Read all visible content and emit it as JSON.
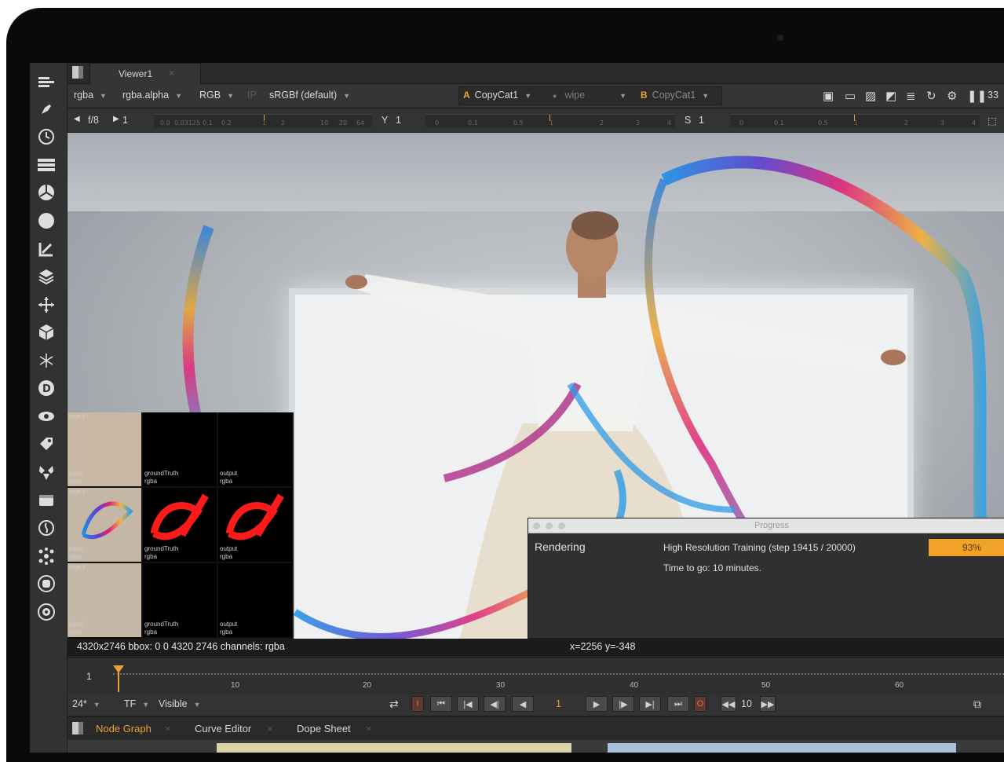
{
  "viewer_tab": {
    "title": "Viewer1",
    "close": "×"
  },
  "controls": {
    "channels": "rgba",
    "alpha": "rgba.alpha",
    "display": "RGB",
    "ip": "IP",
    "colorspace": "sRGBf (default)",
    "a_label": "A",
    "a_input": "CopyCat1",
    "wipe": "wipe",
    "b_label": "B",
    "b_input": "CopyCat1",
    "right_value": "33"
  },
  "sliders": {
    "fstop": "f/8",
    "fstop_value": "1",
    "gain_labels": [
      "0.0",
      "0.03125",
      "0.1",
      "0.2",
      "1",
      "2",
      "10",
      "20",
      "64"
    ],
    "gamma_label": "Y",
    "gamma_value": "1",
    "gamma_ticks": [
      "0",
      "0.1",
      "0.5",
      "1",
      "2",
      "3",
      "4"
    ],
    "sat_label": "S",
    "sat_value": "1",
    "sat_ticks": [
      "0",
      "0.1",
      "0.5",
      "1",
      "2",
      "3",
      "4"
    ]
  },
  "thumbnails": [
    {
      "top": "crop 1",
      "l1": "input",
      "l2": "rgba"
    },
    {
      "top": "",
      "l1": "groundTruth",
      "l2": "rgba"
    },
    {
      "top": "",
      "l1": "output",
      "l2": "rgba"
    },
    {
      "top": "crop 2",
      "l1": "input",
      "l2": "rgba"
    },
    {
      "top": "",
      "l1": "groundTruth",
      "l2": "rgba"
    },
    {
      "top": "",
      "l1": "output",
      "l2": "rgba"
    },
    {
      "top": "crop 3",
      "l1": "input",
      "l2": "rgba"
    },
    {
      "top": "",
      "l1": "groundTruth",
      "l2": "rgba"
    },
    {
      "top": "",
      "l1": "output",
      "l2": "rgba"
    }
  ],
  "progress": {
    "window_title": "Progress",
    "label": "Rendering",
    "task": "High Resolution Training (step 19415 / 20000)",
    "eta": "Time to go: 10 minutes.",
    "percent_text": "93%",
    "percent": 93
  },
  "status": {
    "info": "4320x2746  bbox: 0 0 4320 2746 channels: rgba",
    "coords": "x=2256 y=-348"
  },
  "timeline": {
    "start_frame": "1",
    "ticks": [
      "10",
      "20",
      "30",
      "40",
      "50",
      "60"
    ],
    "current": "1"
  },
  "transport": {
    "fps": "24*",
    "tf": "TF",
    "visible": "Visible",
    "frame": "1",
    "step": "10"
  },
  "node_tabs": [
    "Node Graph",
    "Curve Editor",
    "Dope Sheet"
  ]
}
